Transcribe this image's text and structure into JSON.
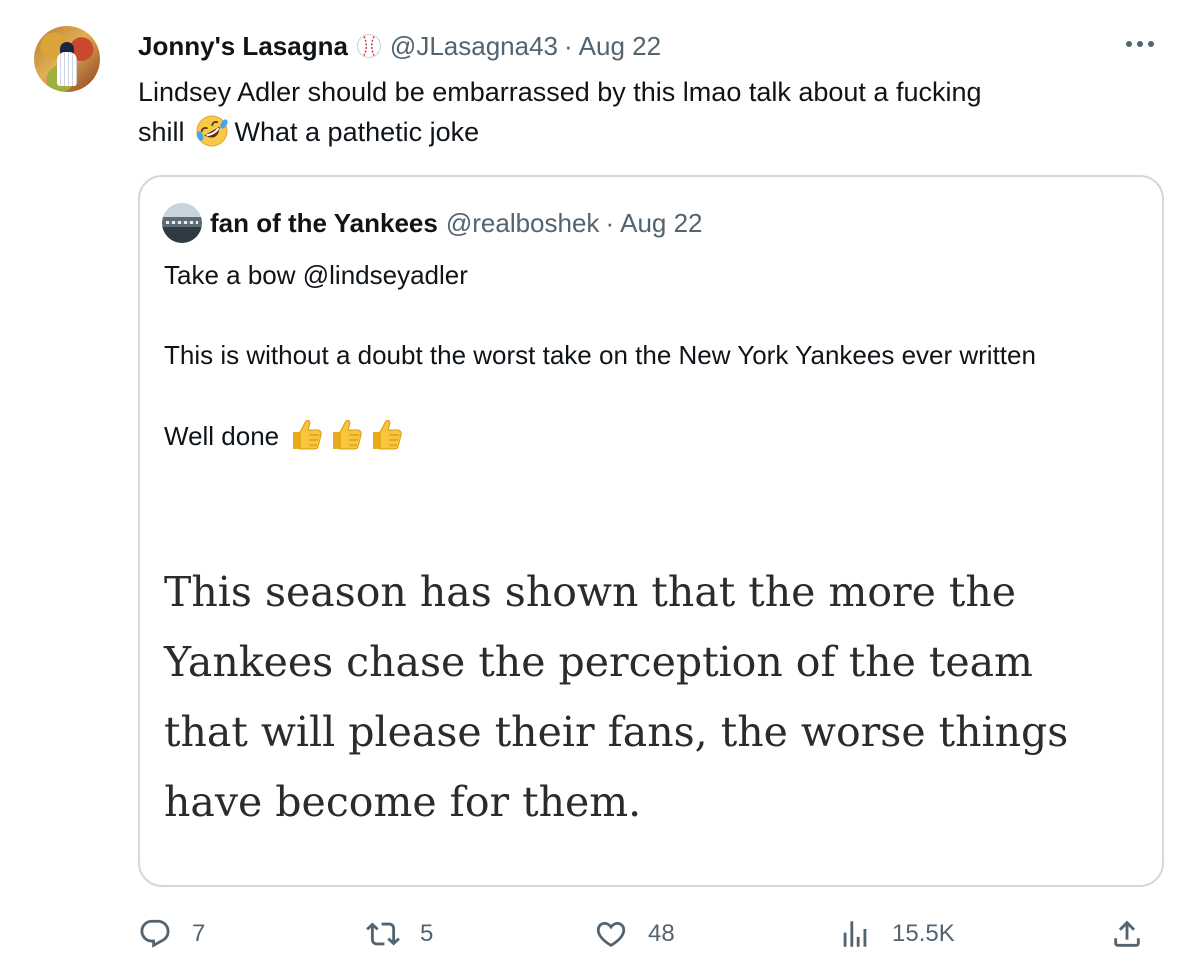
{
  "tweet": {
    "display_name": "Jonny's Lasagna",
    "handle": "@JLasagna43",
    "separator": "·",
    "date": "Aug 22",
    "text_line1": "Lindsey Adler should be embarrassed by this lmao talk about a fucking",
    "text_line2_start": "shill",
    "text_line2_end": "What a pathetic joke",
    "emoji": "rolling-on-floor-laughing-emoji",
    "badge_icon": "baseball-icon"
  },
  "quote": {
    "display_name": "fan of the Yankees",
    "handle": "@realboshek",
    "separator": "·",
    "date": "Aug 22",
    "para1": "Take a bow @lindseyadler",
    "para2": "This is without a doubt the worst take on the New York Yankees ever written",
    "para3": "Well done",
    "emoji": "thumbs-up-emoji",
    "article_text": "This season has shown that the more the Yankees chase the perception of the team that will please their fans, the worse things have become for them."
  },
  "actions": {
    "replies": "7",
    "retweets": "5",
    "likes": "48",
    "views": "15.5K"
  },
  "colors": {
    "text": "#0f1419",
    "secondary": "#536471",
    "border": "#cfd9de"
  }
}
